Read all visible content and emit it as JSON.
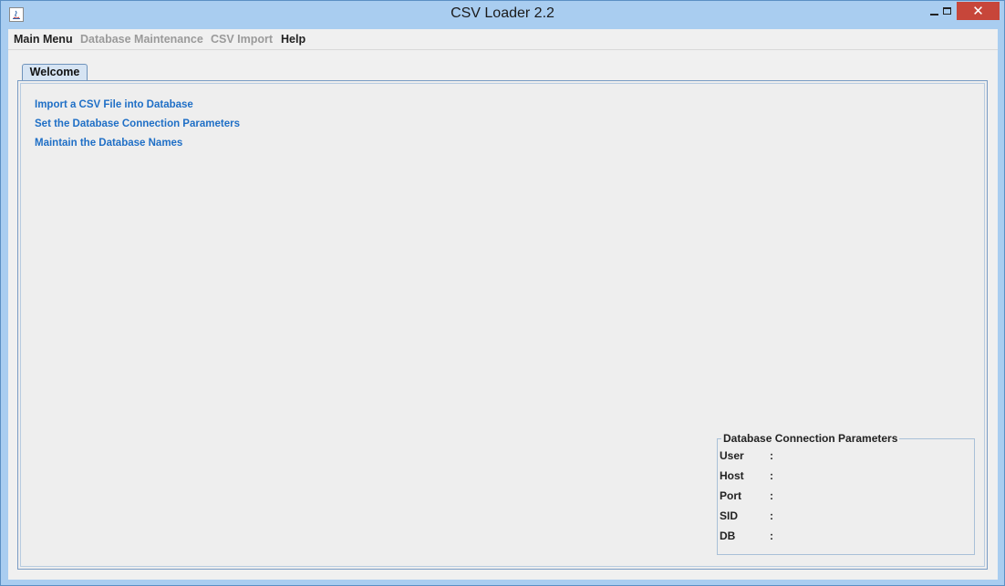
{
  "window": {
    "title": "CSV Loader 2.2"
  },
  "menubar": {
    "items": [
      {
        "label": "Main Menu",
        "enabled": true
      },
      {
        "label": "Database Maintenance",
        "enabled": false
      },
      {
        "label": "CSV Import",
        "enabled": false
      },
      {
        "label": "Help",
        "enabled": true
      }
    ]
  },
  "tabs": [
    {
      "label": "Welcome"
    }
  ],
  "welcome": {
    "links": [
      "Import a CSV File into Database",
      "Set the Database Connection Parameters",
      "Maintain the Database Names"
    ]
  },
  "connection": {
    "title": "Database Connection Parameters",
    "fields": [
      {
        "label": "User",
        "separator": ":"
      },
      {
        "label": "Host",
        "separator": ":"
      },
      {
        "label": "Port",
        "separator": ":"
      },
      {
        "label": "SID",
        "separator": ":"
      },
      {
        "label": "DB",
        "separator": ":"
      }
    ]
  },
  "colors": {
    "link": "#1f6fc6",
    "titlebar": "#a9cdf0",
    "close_button": "#c7463a",
    "disabled_menu": "#9a9a9a"
  },
  "icons": [
    "java-app-icon",
    "minimize-icon",
    "maximize-icon",
    "close-icon"
  ]
}
